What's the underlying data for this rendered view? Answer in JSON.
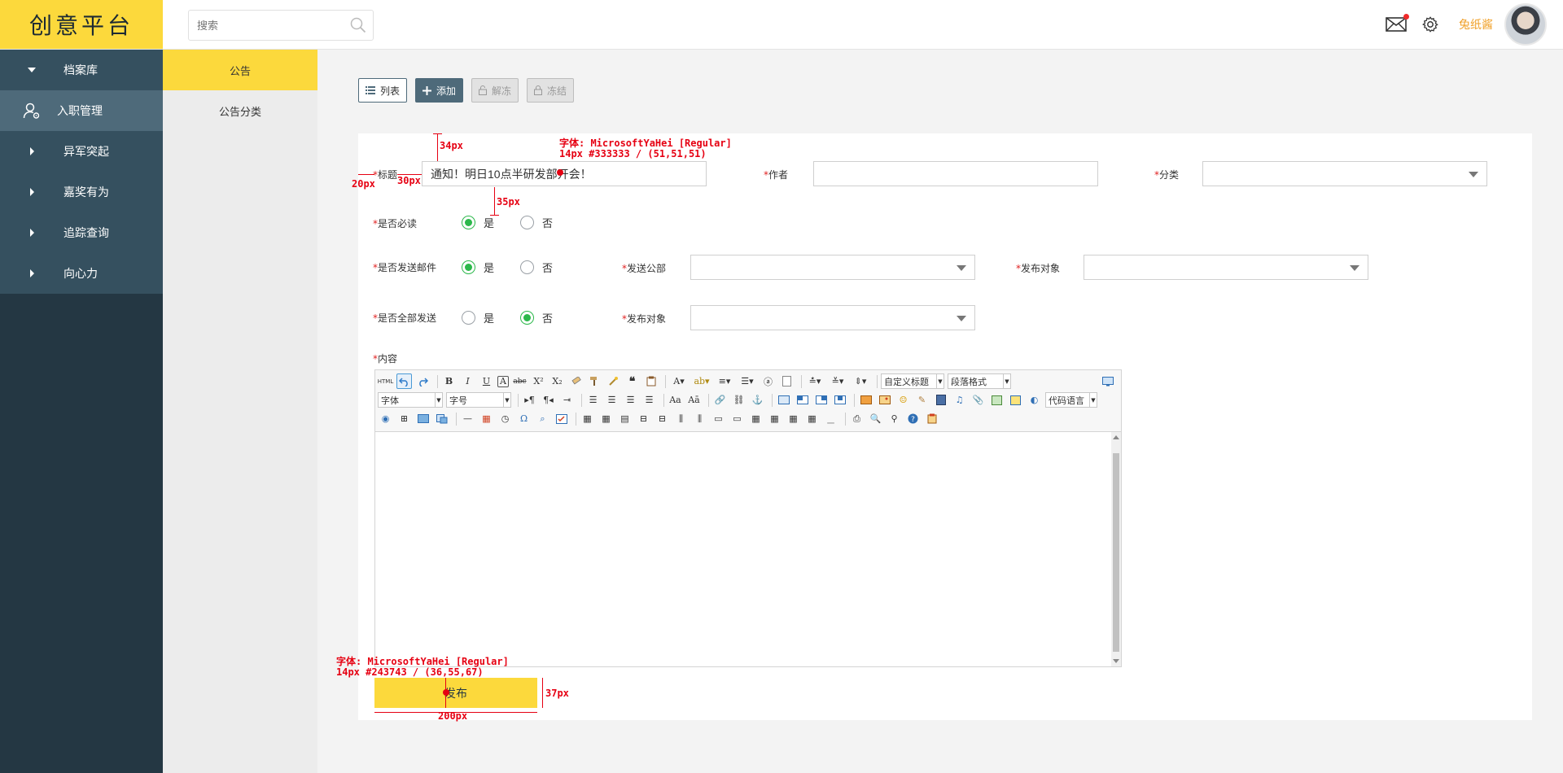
{
  "app": {
    "logo_text": "创意平台"
  },
  "search": {
    "placeholder": "搜索"
  },
  "user": {
    "name": "兔纸酱"
  },
  "sidebar": {
    "items": [
      {
        "label": "档案库",
        "icon": "caret-down-icon"
      },
      {
        "label": "入职管理",
        "icon": "user-settings-icon"
      },
      {
        "label": "异军突起",
        "icon": "caret-right-icon"
      },
      {
        "label": "嘉奖有为",
        "icon": "caret-right-icon"
      },
      {
        "label": "追踪查询",
        "icon": "caret-right-icon"
      },
      {
        "label": "向心力",
        "icon": "caret-right-icon"
      }
    ]
  },
  "subnav": {
    "items": [
      {
        "label": "公告"
      },
      {
        "label": "公告分类"
      }
    ]
  },
  "toolbar": {
    "list": "列表",
    "add": "添加",
    "unfreeze": "解冻",
    "freeze": "冻结"
  },
  "form": {
    "required_mark": "*",
    "title_label": "标题",
    "title_value": "通知！明日10点半研发部开会！",
    "author_label": "作者",
    "author_value": "",
    "category_label": "分类",
    "must_read_label": "是否必读",
    "send_email_label": "是否发送邮件",
    "send_all_label": "是否全部发送",
    "yes": "是",
    "no": "否",
    "send_dept_label": "发送公部",
    "publish_target_label": "发布对象",
    "publish_target_label_2": "发布对象",
    "content_label": "内容",
    "must_read": "是",
    "send_email": "是",
    "send_all": "否"
  },
  "editor": {
    "font_family": "字体",
    "font_size": "字号",
    "custom_heading": "自定义标题",
    "paragraph_format": "段落格式",
    "code_language": "代码语言",
    "html_btn": "HTML"
  },
  "publish_button": "发布",
  "annotations": {
    "a_34": "34px",
    "a_font1_line1": "字体: MicrosoftYaHei [Regular]",
    "a_font1_line2": "14px #333333 / (51,51,51)",
    "a_20": "20px",
    "a_30": "30px",
    "a_35": "35px",
    "a_font2_line1": "字体: MicrosoftYaHei [Regular]",
    "a_font2_line2": "14px #243743 / (36,55,67)",
    "a_37": "37px",
    "a_200": "200px"
  },
  "colors": {
    "brand_yellow": "#fcd93c",
    "nav_dark": "#243743",
    "nav_group": "#35505f",
    "nav_active": "#4e6a7a",
    "radio_green": "#2cb84b",
    "annotation_red": "#e60012"
  }
}
